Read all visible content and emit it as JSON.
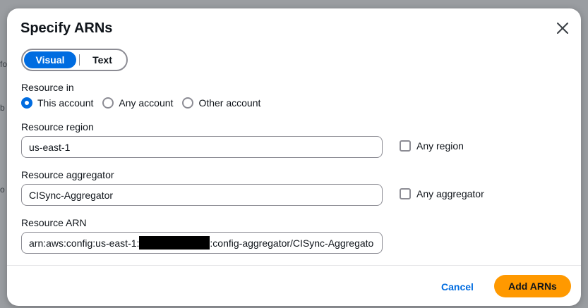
{
  "dialog": {
    "title": "Specify ARNs",
    "close_icon": "close-icon"
  },
  "mode_toggle": {
    "options": [
      "Visual",
      "Text"
    ],
    "selected": "Visual"
  },
  "resource_in": {
    "label": "Resource in",
    "options": [
      "This account",
      "Any account",
      "Other account"
    ],
    "selected": "This account"
  },
  "resource_region": {
    "label": "Resource region",
    "value": "us-east-1",
    "checkbox_label": "Any region",
    "checkbox_checked": false
  },
  "resource_aggregator": {
    "label": "Resource aggregator",
    "value": "CISync-Aggregator",
    "checkbox_label": "Any aggregator",
    "checkbox_checked": false
  },
  "resource_arn": {
    "label": "Resource ARN",
    "value_prefix": "arn:aws:config:us-east-1:",
    "value_suffix": ":config-aggregator/CISync-Aggregato"
  },
  "footer": {
    "cancel_label": "Cancel",
    "primary_label": "Add ARNs"
  },
  "colors": {
    "accent": "#006ce0",
    "primary_button": "#ff9900"
  }
}
